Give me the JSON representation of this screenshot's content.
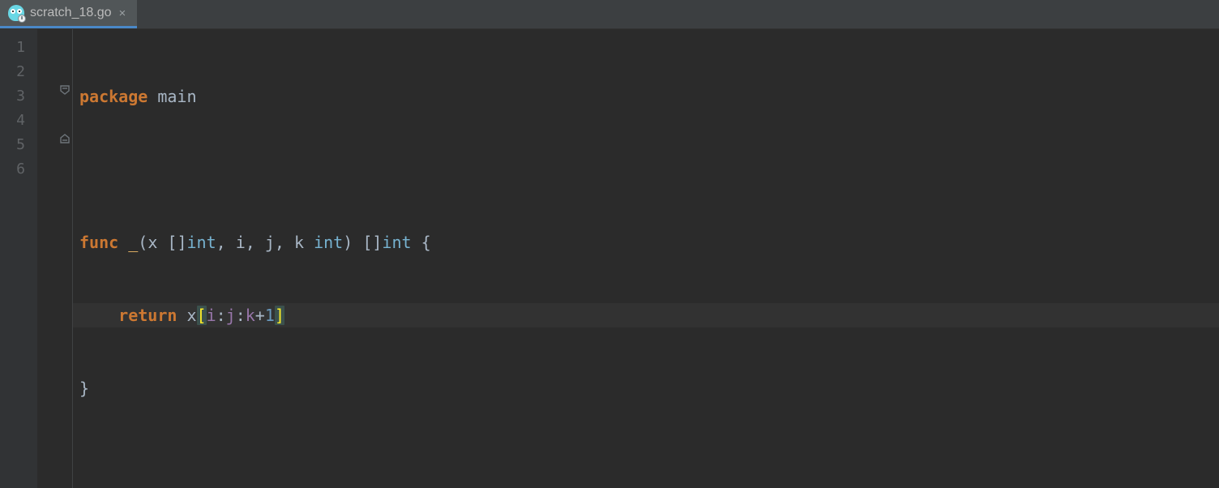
{
  "tab": {
    "filename": "scratch_18.go",
    "icon": "gopher-file-icon",
    "close_glyph": "×"
  },
  "editor": {
    "highlighted_line": 4,
    "gutter": [
      "1",
      "2",
      "3",
      "4",
      "5",
      "6"
    ],
    "code": {
      "l1": {
        "kw": "package",
        "name": "main"
      },
      "l3": {
        "kw": "func",
        "fn": "_",
        "p_open": "(",
        "param_x": "x",
        "slice_open": "[",
        "slice_close": "]",
        "type_int": "int",
        "comma1": ",",
        "param_i": "i",
        "comma2": ",",
        "param_j": "j",
        "comma3": ",",
        "param_k": "k",
        "p_close": ")",
        "ret_open": "[",
        "ret_close": "]",
        "brace_open": "{"
      },
      "l4": {
        "kw": "return",
        "x": "x",
        "b_open": "[",
        "i": "i",
        "colon1": ":",
        "j": "j",
        "colon2": ":",
        "k": "k",
        "plus": "+",
        "one": "1",
        "b_close": "]"
      },
      "l5": {
        "brace_close": "}"
      }
    }
  }
}
